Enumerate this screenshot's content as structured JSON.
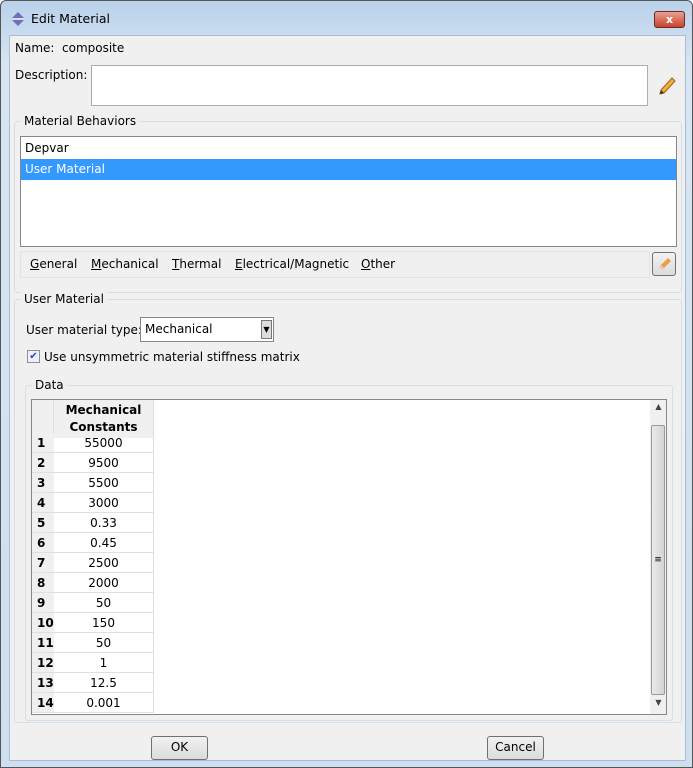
{
  "window": {
    "title": "Edit Material",
    "close": "x"
  },
  "name": {
    "label": "Name:",
    "value": "composite"
  },
  "description": {
    "label": "Description:",
    "value": ""
  },
  "behaviors": {
    "title": "Material Behaviors",
    "items": [
      {
        "label": "Depvar",
        "selected": false
      },
      {
        "label": "User Material",
        "selected": true
      }
    ]
  },
  "menu": [
    {
      "label": "General",
      "mnemonic": "G"
    },
    {
      "label": "Mechanical",
      "mnemonic": "M"
    },
    {
      "label": "Thermal",
      "mnemonic": "T"
    },
    {
      "label": "Electrical/Magnetic",
      "mnemonic": "E"
    },
    {
      "label": "Other",
      "mnemonic": "O"
    }
  ],
  "user_material": {
    "title": "User Material",
    "type_label": "User material type:",
    "type_value": "Mechanical",
    "unsym_label": "Use unsymmetric material stiffness matrix",
    "unsym_checked": true
  },
  "data": {
    "title": "Data",
    "header_line1": "Mechanical",
    "header_line2": "Constants",
    "rows": [
      {
        "n": "1",
        "v": "55000"
      },
      {
        "n": "2",
        "v": "9500"
      },
      {
        "n": "3",
        "v": "5500"
      },
      {
        "n": "4",
        "v": "3000"
      },
      {
        "n": "5",
        "v": "0.33"
      },
      {
        "n": "6",
        "v": "0.45"
      },
      {
        "n": "7",
        "v": "2500"
      },
      {
        "n": "8",
        "v": "2000"
      },
      {
        "n": "9",
        "v": "50"
      },
      {
        "n": "10",
        "v": "150"
      },
      {
        "n": "11",
        "v": "50"
      },
      {
        "n": "12",
        "v": "1"
      },
      {
        "n": "13",
        "v": "12.5"
      },
      {
        "n": "14",
        "v": "0.001"
      }
    ]
  },
  "buttons": {
    "ok": "OK",
    "cancel": "Cancel"
  },
  "colors": {
    "selection": "#3399ff",
    "close": "#c7432b"
  }
}
